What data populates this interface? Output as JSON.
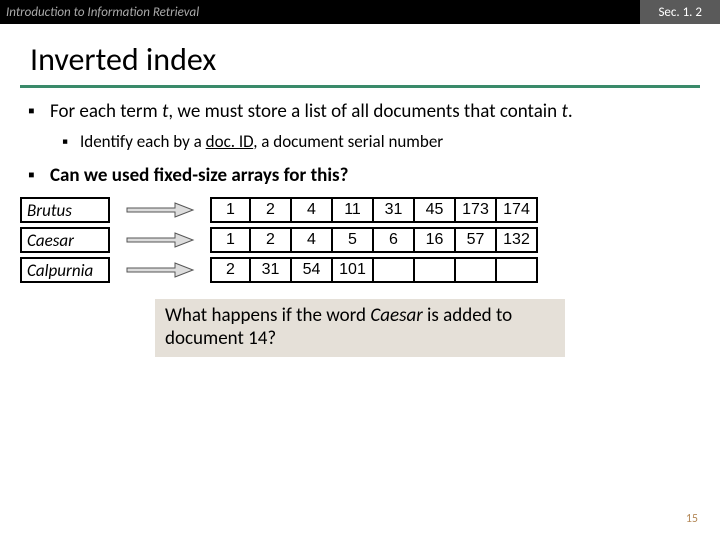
{
  "header": {
    "left": "Introduction to Information Retrieval",
    "right": "Sec. 1. 2"
  },
  "title": "Inverted index",
  "bullets": {
    "b1a": "For each term ",
    "b1it": "t",
    "b1b": ", we must store a list of all documents that contain ",
    "b1it2": "t",
    "b1c": ".",
    "s1a": "Identify each by a ",
    "s1u": "doc. ID",
    "s1b": ", a document serial number",
    "b2": "Can we used fixed-size arrays for this?"
  },
  "terms": [
    "Brutus",
    "Caesar",
    "Calpurnia"
  ],
  "rows": [
    [
      "1",
      "2",
      "4",
      "11",
      "31",
      "45",
      "173",
      "174"
    ],
    [
      "1",
      "2",
      "4",
      "5",
      "6",
      "16",
      "57",
      "132"
    ],
    [
      "2",
      "31",
      "54",
      "101",
      "",
      "",
      "",
      ""
    ]
  ],
  "footer": {
    "a": "What happens if the word ",
    "w": "Caesar",
    "b": " is added to document 14?"
  },
  "page": "15"
}
